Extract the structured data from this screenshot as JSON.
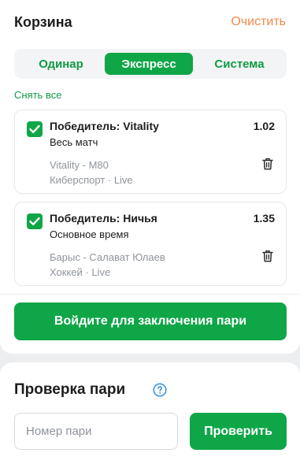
{
  "cart": {
    "title": "Корзина",
    "clear_label": "Очистить",
    "tabs": [
      {
        "label": "Одинар",
        "active": false
      },
      {
        "label": "Экспресс",
        "active": true
      },
      {
        "label": "Система",
        "active": false
      }
    ],
    "uncheck_all_label": "Снять все",
    "bets": [
      {
        "checked": true,
        "title": "Победитель: Vitality",
        "odds": "1.02",
        "subtitle": "Весь матч",
        "event": "Vitality - M80",
        "sport": "Киберспорт · Live"
      },
      {
        "checked": true,
        "title": "Победитель: Ничья",
        "odds": "1.35",
        "subtitle": "Основное время",
        "event": "Барыс - Салават Юлаев",
        "sport": "Хоккей · Live"
      }
    ],
    "login_button_label": "Войдите для заключения пари"
  },
  "bet_check": {
    "title": "Проверка пари",
    "input_placeholder": "Номер пари",
    "input_value": "",
    "verify_button_label": "Проверить"
  },
  "colors": {
    "accent_green": "#0fa648",
    "link_orange": "#f0894a",
    "muted_text": "#8f949b",
    "help_blue": "#2d8ee0"
  },
  "icons": {
    "checkbox": "check-icon",
    "delete": "trash-icon",
    "help": "question-circle-icon"
  }
}
